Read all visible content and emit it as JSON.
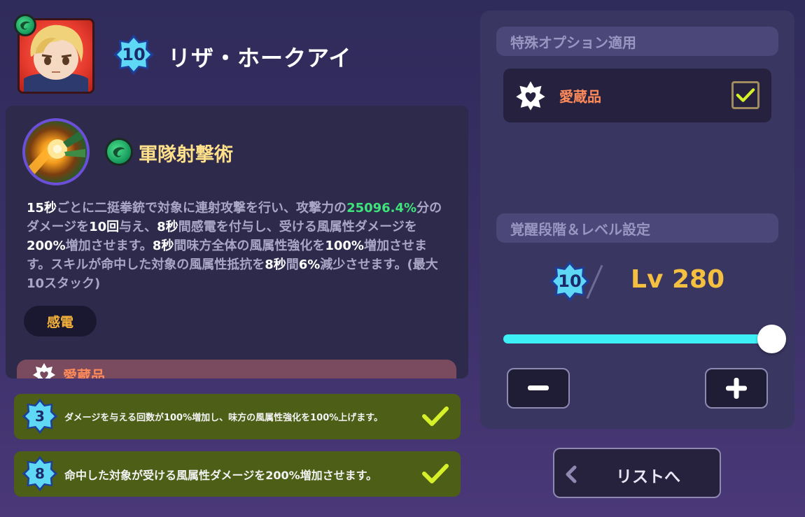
{
  "character": {
    "level_badge": "10",
    "name": "リザ・ホークアイ",
    "element_icon": "wind-element-icon"
  },
  "skill": {
    "name": "軍隊射撃術",
    "desc": {
      "p1": "15秒",
      "p2": "ごとに二挺拳銃で対象に連射攻撃を行い、攻撃力の",
      "p3": "25096.4%",
      "p4": "分のダメージを",
      "p5": "10回",
      "p6": "与え、",
      "p7": "8秒",
      "p8": "間感電を付与し、受ける風属性ダメージを",
      "p9": "200%",
      "p10": "増加させます。",
      "p11": "8秒",
      "p12": "間味方全体の風属性強化を",
      "p13": "100%",
      "p14": "増加させます。スキルが命中した対象の風属性抵抗を",
      "p15": "8秒",
      "p16": "間",
      "p17": "6%",
      "p18": "減少させます。(最大10スタック)"
    },
    "tag": "感電",
    "treasure_label": "愛蔵品"
  },
  "bonuses": [
    {
      "badge": "3",
      "text": "ダメージを与える回数が100%増加し、味方の風属性強化を100%上げます。",
      "checked": true
    },
    {
      "badge": "8",
      "text": "命中した対象が受ける風属性ダメージを200%増加させます。",
      "checked": true
    }
  ],
  "options": {
    "header": "特殊オプション適用",
    "treasure_label": "愛蔵品",
    "treasure_checked": true
  },
  "awaken": {
    "header": "覚醒段階＆レベル設定",
    "stage_badge": "10",
    "level_text": "Lv 280",
    "level_fill": 1.0
  },
  "list_button": {
    "label": "リストへ"
  },
  "colors": {
    "accent_cyan": "#3cf0f5",
    "gold": "#f5c040",
    "green_value": "#3fe37c",
    "check_yellow": "#d6f02a",
    "bonus_bg": "#4d5e16"
  }
}
